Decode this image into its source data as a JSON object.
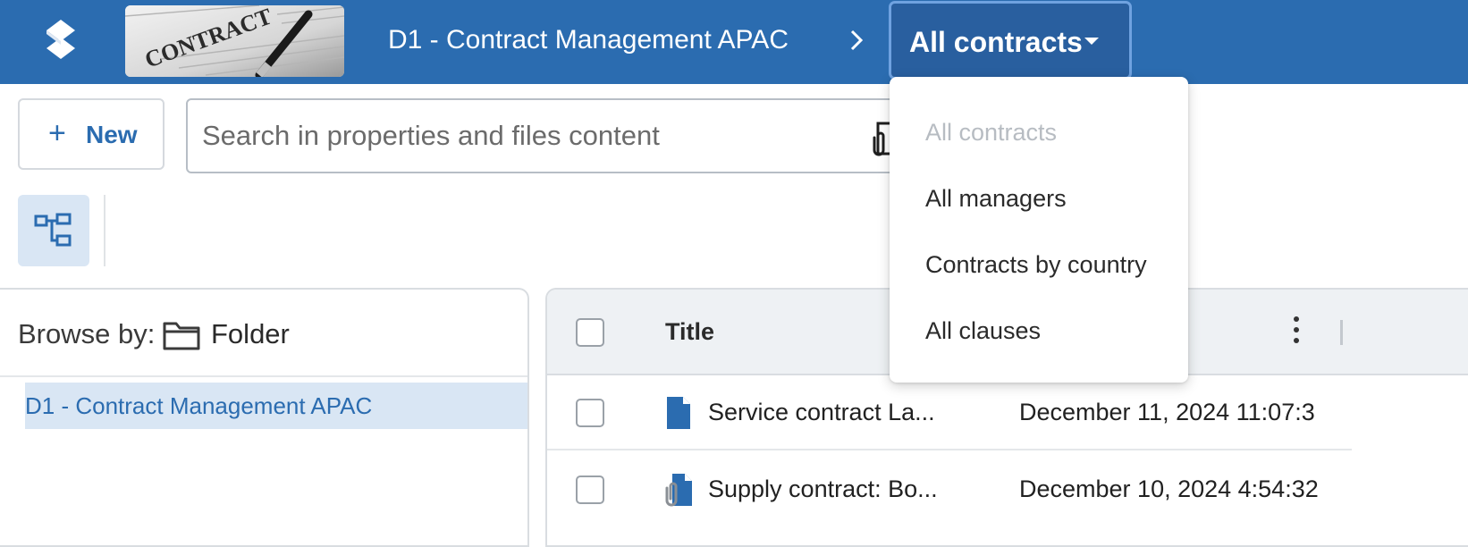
{
  "header": {
    "breadcrumb": "D1 - Contract Management APAC",
    "current_view": "All contracts",
    "banner_text": "CONTRACT",
    "colors": {
      "bar": "#2b6cb0",
      "view_button": "#295f9f",
      "view_button_border": "#6fa2e0"
    }
  },
  "toolbar": {
    "new_label": "New",
    "search_placeholder": "Search in properties and files content"
  },
  "browse": {
    "label": "Browse by:",
    "mode": "Folder",
    "selected_node": "D1 - Contract Management APAC"
  },
  "table": {
    "columns": [
      "Title"
    ],
    "rows": [
      {
        "title": "Service contract La...",
        "date": "December 11, 2024 11:07:3",
        "icon": "document-icon"
      },
      {
        "title": "Supply contract: Bo...",
        "date": "December 10, 2024 4:54:32",
        "icon": "document-attachment-icon"
      }
    ]
  },
  "view_menu": {
    "items": [
      {
        "label": "All contracts",
        "disabled": true
      },
      {
        "label": "All managers",
        "disabled": false
      },
      {
        "label": "Contracts by country",
        "disabled": false
      },
      {
        "label": "All clauses",
        "disabled": false
      }
    ]
  }
}
